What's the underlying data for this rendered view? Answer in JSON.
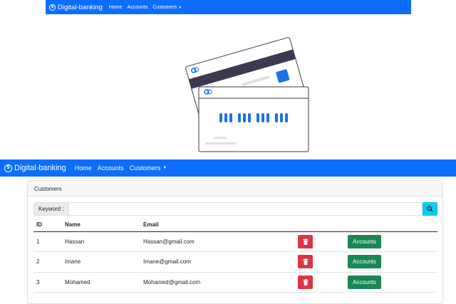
{
  "top_navbar": {
    "brand": "Digital-banking",
    "links": [
      "Home",
      "Accounts",
      "Customers"
    ]
  },
  "navbar": {
    "brand": "Digital-banking",
    "links": [
      "Home",
      "Accounts",
      "Customers"
    ]
  },
  "customers_card": {
    "title": "Customers",
    "search": {
      "label": "Keyword :",
      "value": ""
    },
    "columns": [
      "ID",
      "Name",
      "Email"
    ],
    "rows": [
      {
        "id": "1",
        "name": "Hassan",
        "email": "Hassan@gmail.com",
        "accounts_label": "Accounts"
      },
      {
        "id": "2",
        "name": "Imane",
        "email": "Imane@gmail.com",
        "accounts_label": "Accounts"
      },
      {
        "id": "3",
        "name": "Mohamed",
        "email": "Mohamed@gmail.com",
        "accounts_label": "Accounts"
      }
    ]
  },
  "colors": {
    "primary": "#0d6efd",
    "danger": "#dc3545",
    "success": "#198754",
    "info": "#0dcaf0"
  }
}
